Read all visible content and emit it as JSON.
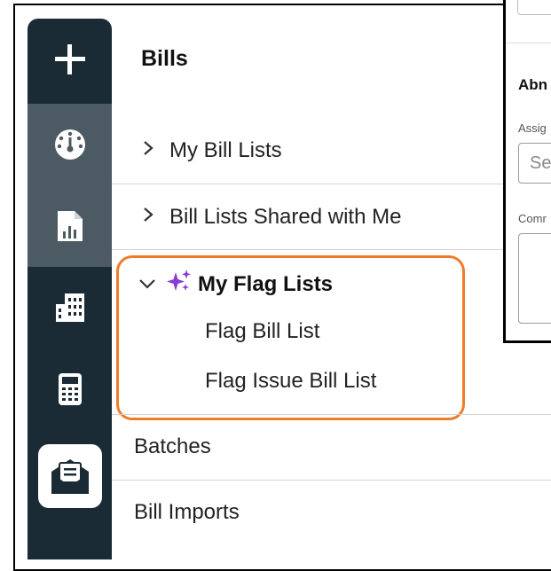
{
  "sidebar": {
    "items": [
      {
        "icon": "plus-icon"
      },
      {
        "icon": "dashboard-gauge-icon",
        "active": true
      },
      {
        "icon": "report-chart-icon",
        "active": true
      },
      {
        "icon": "building-icon"
      },
      {
        "icon": "calculator-icon"
      },
      {
        "icon": "mail-document-icon"
      }
    ]
  },
  "panel": {
    "title": "Bills",
    "my_bill_lists": "My Bill Lists",
    "shared_lists": "Bill Lists Shared with Me",
    "flag_lists": {
      "label": "My Flag Lists",
      "icon": "sparkle-icon",
      "items": [
        "Flag Bill List",
        "Flag Issue Bill List"
      ]
    },
    "batches": "Batches",
    "bill_imports": "Bill Imports"
  },
  "dialog": {
    "heading": "Abn",
    "assign_label": "Assig",
    "select_placeholder": "Se",
    "comment_label": "Comr"
  },
  "colors": {
    "rail": "#1b2b36",
    "rail_active": "#4c5a63",
    "highlight": "#f07c2a",
    "sparkle": "#8a3ad6"
  }
}
